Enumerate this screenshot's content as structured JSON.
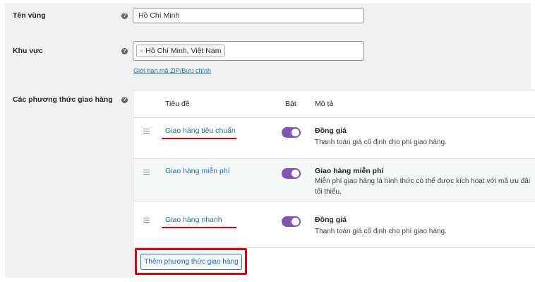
{
  "zone_name": {
    "label": "Tên vùng",
    "value": "Hồ Chí Minh"
  },
  "region": {
    "label": "Khu vực",
    "tag": "Hồ Chí Minh, Việt Nam",
    "tag_remove": "×",
    "limit_link": "Giới hạn mã ZIP/Bưu chính"
  },
  "methods": {
    "label": "Các phương thức giao hàng",
    "columns": {
      "title": "Tiêu đề",
      "enabled": "Bật",
      "description": "Mô tả"
    },
    "rows": [
      {
        "title": "Giao hàng tiêu chuẩn",
        "enabled": true,
        "desc_title": "Đồng giá",
        "desc_line1": "Thanh toán giá cố định cho phí giao hàng.",
        "desc_line2": ""
      },
      {
        "title": "Giao hàng miễn phí",
        "enabled": true,
        "desc_title": "Giao hàng miễn phí",
        "desc_line1": "Miễn phí giao hàng là hình thức có thể được kích hoạt với mã ưu đãi",
        "desc_line2": "tối thiểu."
      },
      {
        "title": "Giao hàng nhanh",
        "enabled": true,
        "desc_title": "Đồng giá",
        "desc_line1": "Thanh toán giá cố định cho phí giao hàng.",
        "desc_line2": ""
      }
    ],
    "add_button": "Thêm phương thức giao hàng"
  },
  "help_icon": "question-circle",
  "colors": {
    "toggle_on": "#7f54b3",
    "link": "#2271b1",
    "highlight": "#e0000f"
  }
}
